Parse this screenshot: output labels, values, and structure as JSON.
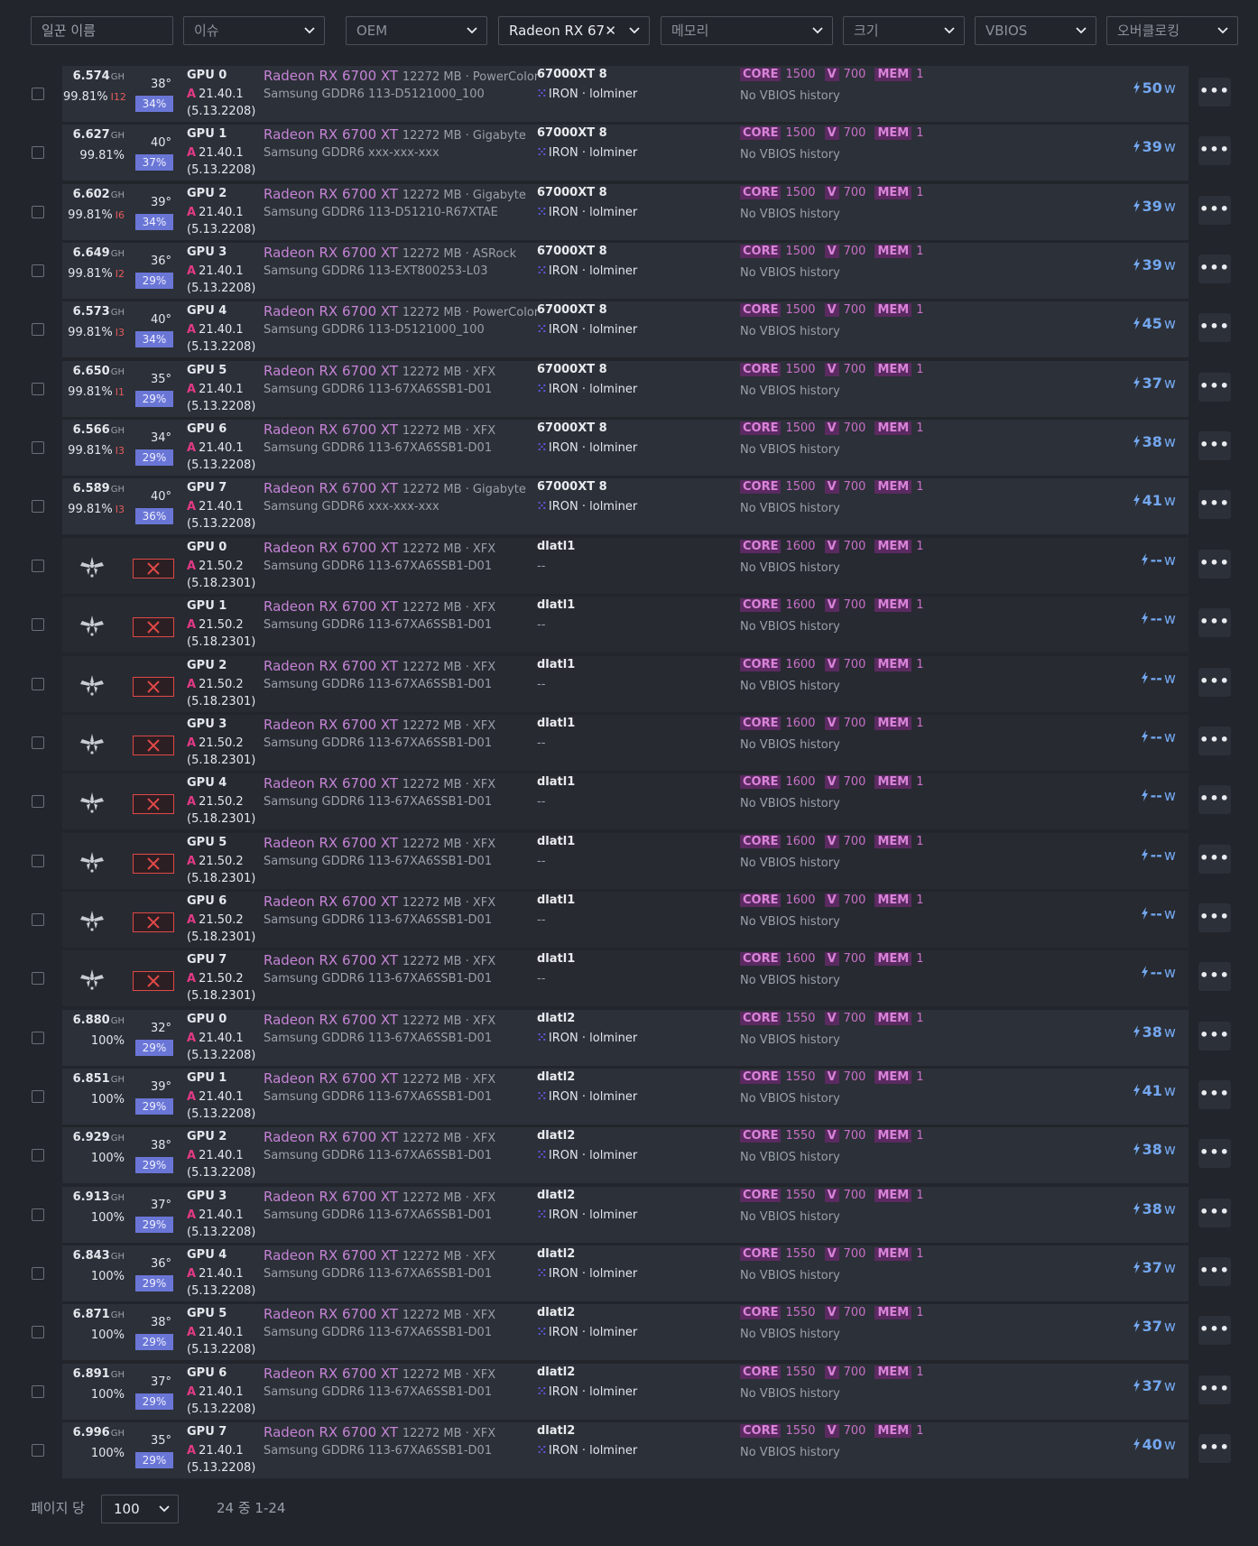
{
  "filters": [
    {
      "label": "일꾼 이름",
      "kind": "input"
    },
    {
      "label": "이슈",
      "kind": "select"
    },
    {
      "label": "OEM",
      "kind": "select"
    },
    {
      "label": "Radeon RX 67",
      "kind": "select-active",
      "clear": "✕"
    },
    {
      "label": "메모리",
      "kind": "select"
    },
    {
      "label": "크기",
      "kind": "select"
    },
    {
      "label": "VBIOS",
      "kind": "select"
    },
    {
      "label": "오버클로킹",
      "kind": "select"
    }
  ],
  "units": {
    "hash": "GH",
    "power": "w",
    "mb": "MB"
  },
  "labels": {
    "core": "CORE",
    "v": "V",
    "mem": "MEM",
    "no_vbios": "No VBIOS history"
  },
  "rows": [
    {
      "state": "ok",
      "hash": "6.574",
      "share": "99.81%",
      "rej": "12",
      "temp": "38°",
      "fan": "34%",
      "gpu": "GPU 0",
      "drv": "21.40.1",
      "kern": "(5.13.2208)",
      "model": "Radeon RX 6700 XT",
      "meta": "12272 MB · PowerColor",
      "mem": "Samsung GDDR6 113-D5121000_100",
      "rig": "67000XT 8",
      "coin": "IRON · lolminer",
      "core": "1500",
      "v": "700",
      "memoc": "1",
      "power": "50"
    },
    {
      "state": "ok",
      "hash": "6.627",
      "share": "99.81%",
      "rej": "",
      "temp": "40°",
      "fan": "37%",
      "gpu": "GPU 1",
      "drv": "21.40.1",
      "kern": "(5.13.2208)",
      "model": "Radeon RX 6700 XT",
      "meta": "12272 MB · Gigabyte",
      "mem": "Samsung GDDR6 xxx-xxx-xxx",
      "rig": "67000XT 8",
      "coin": "IRON · lolminer",
      "core": "1500",
      "v": "700",
      "memoc": "1",
      "power": "39"
    },
    {
      "state": "ok",
      "hash": "6.602",
      "share": "99.81%",
      "rej": "6",
      "temp": "39°",
      "fan": "34%",
      "gpu": "GPU 2",
      "drv": "21.40.1",
      "kern": "(5.13.2208)",
      "model": "Radeon RX 6700 XT",
      "meta": "12272 MB · Gigabyte",
      "mem": "Samsung GDDR6 113-D51210-R67XTAE",
      "rig": "67000XT 8",
      "coin": "IRON · lolminer",
      "core": "1500",
      "v": "700",
      "memoc": "1",
      "power": "39"
    },
    {
      "state": "ok",
      "hash": "6.649",
      "share": "99.81%",
      "rej": "2",
      "temp": "36°",
      "fan": "29%",
      "gpu": "GPU 3",
      "drv": "21.40.1",
      "kern": "(5.13.2208)",
      "model": "Radeon RX 6700 XT",
      "meta": "12272 MB · ASRock",
      "mem": "Samsung GDDR6 113-EXT800253-L03",
      "rig": "67000XT 8",
      "coin": "IRON · lolminer",
      "core": "1500",
      "v": "700",
      "memoc": "1",
      "power": "39"
    },
    {
      "state": "ok",
      "hash": "6.573",
      "share": "99.81%",
      "rej": "3",
      "temp": "40°",
      "fan": "34%",
      "gpu": "GPU 4",
      "drv": "21.40.1",
      "kern": "(5.13.2208)",
      "model": "Radeon RX 6700 XT",
      "meta": "12272 MB · PowerColor",
      "mem": "Samsung GDDR6 113-D5121000_100",
      "rig": "67000XT 8",
      "coin": "IRON · lolminer",
      "core": "1500",
      "v": "700",
      "memoc": "1",
      "power": "45"
    },
    {
      "state": "ok",
      "hash": "6.650",
      "share": "99.81%",
      "rej": "1",
      "temp": "35°",
      "fan": "29%",
      "gpu": "GPU 5",
      "drv": "21.40.1",
      "kern": "(5.13.2208)",
      "model": "Radeon RX 6700 XT",
      "meta": "12272 MB · XFX",
      "mem": "Samsung GDDR6 113-67XA6SSB1-D01",
      "rig": "67000XT 8",
      "coin": "IRON · lolminer",
      "core": "1500",
      "v": "700",
      "memoc": "1",
      "power": "37"
    },
    {
      "state": "ok",
      "hash": "6.566",
      "share": "99.81%",
      "rej": "3",
      "temp": "34°",
      "fan": "29%",
      "gpu": "GPU 6",
      "drv": "21.40.1",
      "kern": "(5.13.2208)",
      "model": "Radeon RX 6700 XT",
      "meta": "12272 MB · XFX",
      "mem": "Samsung GDDR6 113-67XA6SSB1-D01",
      "rig": "67000XT 8",
      "coin": "IRON · lolminer",
      "core": "1500",
      "v": "700",
      "memoc": "1",
      "power": "38"
    },
    {
      "state": "ok",
      "hash": "6.589",
      "share": "99.81%",
      "rej": "3",
      "temp": "40°",
      "fan": "36%",
      "gpu": "GPU 7",
      "drv": "21.40.1",
      "kern": "(5.13.2208)",
      "model": "Radeon RX 6700 XT",
      "meta": "12272 MB · Gigabyte",
      "mem": "Samsung GDDR6 xxx-xxx-xxx",
      "rig": "67000XT 8",
      "coin": "IRON · lolminer",
      "core": "1500",
      "v": "700",
      "memoc": "1",
      "power": "41"
    },
    {
      "state": "dead",
      "gpu": "GPU 0",
      "drv": "21.50.2",
      "kern": "(5.18.2301)",
      "model": "Radeon RX 6700 XT",
      "meta": "12272 MB · XFX",
      "mem": "Samsung GDDR6 113-67XA6SSB1-D01",
      "rig": "dlatl1",
      "coin": "--",
      "core": "1600",
      "v": "700",
      "memoc": "1",
      "power": "--"
    },
    {
      "state": "dead",
      "gpu": "GPU 1",
      "drv": "21.50.2",
      "kern": "(5.18.2301)",
      "model": "Radeon RX 6700 XT",
      "meta": "12272 MB · XFX",
      "mem": "Samsung GDDR6 113-67XA6SSB1-D01",
      "rig": "dlatl1",
      "coin": "--",
      "core": "1600",
      "v": "700",
      "memoc": "1",
      "power": "--"
    },
    {
      "state": "dead",
      "gpu": "GPU 2",
      "drv": "21.50.2",
      "kern": "(5.18.2301)",
      "model": "Radeon RX 6700 XT",
      "meta": "12272 MB · XFX",
      "mem": "Samsung GDDR6 113-67XA6SSB1-D01",
      "rig": "dlatl1",
      "coin": "--",
      "core": "1600",
      "v": "700",
      "memoc": "1",
      "power": "--"
    },
    {
      "state": "dead",
      "gpu": "GPU 3",
      "drv": "21.50.2",
      "kern": "(5.18.2301)",
      "model": "Radeon RX 6700 XT",
      "meta": "12272 MB · XFX",
      "mem": "Samsung GDDR6 113-67XA6SSB1-D01",
      "rig": "dlatl1",
      "coin": "--",
      "core": "1600",
      "v": "700",
      "memoc": "1",
      "power": "--"
    },
    {
      "state": "dead",
      "gpu": "GPU 4",
      "drv": "21.50.2",
      "kern": "(5.18.2301)",
      "model": "Radeon RX 6700 XT",
      "meta": "12272 MB · XFX",
      "mem": "Samsung GDDR6 113-67XA6SSB1-D01",
      "rig": "dlatl1",
      "coin": "--",
      "core": "1600",
      "v": "700",
      "memoc": "1",
      "power": "--"
    },
    {
      "state": "dead",
      "gpu": "GPU 5",
      "drv": "21.50.2",
      "kern": "(5.18.2301)",
      "model": "Radeon RX 6700 XT",
      "meta": "12272 MB · XFX",
      "mem": "Samsung GDDR6 113-67XA6SSB1-D01",
      "rig": "dlatl1",
      "coin": "--",
      "core": "1600",
      "v": "700",
      "memoc": "1",
      "power": "--"
    },
    {
      "state": "dead",
      "gpu": "GPU 6",
      "drv": "21.50.2",
      "kern": "(5.18.2301)",
      "model": "Radeon RX 6700 XT",
      "meta": "12272 MB · XFX",
      "mem": "Samsung GDDR6 113-67XA6SSB1-D01",
      "rig": "dlatl1",
      "coin": "--",
      "core": "1600",
      "v": "700",
      "memoc": "1",
      "power": "--"
    },
    {
      "state": "dead",
      "gpu": "GPU 7",
      "drv": "21.50.2",
      "kern": "(5.18.2301)",
      "model": "Radeon RX 6700 XT",
      "meta": "12272 MB · XFX",
      "mem": "Samsung GDDR6 113-67XA6SSB1-D01",
      "rig": "dlatl1",
      "coin": "--",
      "core": "1600",
      "v": "700",
      "memoc": "1",
      "power": "--"
    },
    {
      "state": "ok",
      "hash": "6.880",
      "share": "100%",
      "rej": "",
      "temp": "32°",
      "fan": "29%",
      "gpu": "GPU 0",
      "drv": "21.40.1",
      "kern": "(5.13.2208)",
      "model": "Radeon RX 6700 XT",
      "meta": "12272 MB · XFX",
      "mem": "Samsung GDDR6 113-67XA6SSB1-D01",
      "rig": "dlatl2",
      "coin": "IRON · lolminer",
      "core": "1550",
      "v": "700",
      "memoc": "1",
      "power": "38"
    },
    {
      "state": "ok",
      "hash": "6.851",
      "share": "100%",
      "rej": "",
      "temp": "39°",
      "fan": "29%",
      "gpu": "GPU 1",
      "drv": "21.40.1",
      "kern": "(5.13.2208)",
      "model": "Radeon RX 6700 XT",
      "meta": "12272 MB · XFX",
      "mem": "Samsung GDDR6 113-67XA6SSB1-D01",
      "rig": "dlatl2",
      "coin": "IRON · lolminer",
      "core": "1550",
      "v": "700",
      "memoc": "1",
      "power": "41"
    },
    {
      "state": "ok",
      "hash": "6.929",
      "share": "100%",
      "rej": "",
      "temp": "38°",
      "fan": "29%",
      "gpu": "GPU 2",
      "drv": "21.40.1",
      "kern": "(5.13.2208)",
      "model": "Radeon RX 6700 XT",
      "meta": "12272 MB · XFX",
      "mem": "Samsung GDDR6 113-67XA6SSB1-D01",
      "rig": "dlatl2",
      "coin": "IRON · lolminer",
      "core": "1550",
      "v": "700",
      "memoc": "1",
      "power": "38"
    },
    {
      "state": "ok",
      "hash": "6.913",
      "share": "100%",
      "rej": "",
      "temp": "37°",
      "fan": "29%",
      "gpu": "GPU 3",
      "drv": "21.40.1",
      "kern": "(5.13.2208)",
      "model": "Radeon RX 6700 XT",
      "meta": "12272 MB · XFX",
      "mem": "Samsung GDDR6 113-67XA6SSB1-D01",
      "rig": "dlatl2",
      "coin": "IRON · lolminer",
      "core": "1550",
      "v": "700",
      "memoc": "1",
      "power": "38"
    },
    {
      "state": "ok",
      "hash": "6.843",
      "share": "100%",
      "rej": "",
      "temp": "36°",
      "fan": "29%",
      "gpu": "GPU 4",
      "drv": "21.40.1",
      "kern": "(5.13.2208)",
      "model": "Radeon RX 6700 XT",
      "meta": "12272 MB · XFX",
      "mem": "Samsung GDDR6 113-67XA6SSB1-D01",
      "rig": "dlatl2",
      "coin": "IRON · lolminer",
      "core": "1550",
      "v": "700",
      "memoc": "1",
      "power": "37"
    },
    {
      "state": "ok",
      "hash": "6.871",
      "share": "100%",
      "rej": "",
      "temp": "38°",
      "fan": "29%",
      "gpu": "GPU 5",
      "drv": "21.40.1",
      "kern": "(5.13.2208)",
      "model": "Radeon RX 6700 XT",
      "meta": "12272 MB · XFX",
      "mem": "Samsung GDDR6 113-67XA6SSB1-D01",
      "rig": "dlatl2",
      "coin": "IRON · lolminer",
      "core": "1550",
      "v": "700",
      "memoc": "1",
      "power": "37"
    },
    {
      "state": "ok",
      "hash": "6.891",
      "share": "100%",
      "rej": "",
      "temp": "37°",
      "fan": "29%",
      "gpu": "GPU 6",
      "drv": "21.40.1",
      "kern": "(5.13.2208)",
      "model": "Radeon RX 6700 XT",
      "meta": "12272 MB · XFX",
      "mem": "Samsung GDDR6 113-67XA6SSB1-D01",
      "rig": "dlatl2",
      "coin": "IRON · lolminer",
      "core": "1550",
      "v": "700",
      "memoc": "1",
      "power": "37"
    },
    {
      "state": "ok",
      "hash": "6.996",
      "share": "100%",
      "rej": "",
      "temp": "35°",
      "fan": "29%",
      "gpu": "GPU 7",
      "drv": "21.40.1",
      "kern": "(5.13.2208)",
      "model": "Radeon RX 6700 XT",
      "meta": "12272 MB · XFX",
      "mem": "Samsung GDDR6 113-67XA6SSB1-D01",
      "rig": "dlatl2",
      "coin": "IRON · lolminer",
      "core": "1550",
      "v": "700",
      "memoc": "1",
      "power": "40"
    }
  ],
  "footer": {
    "per_page_label": "페이지 당",
    "per_page_value": "100",
    "total": "24 중 1-24"
  }
}
